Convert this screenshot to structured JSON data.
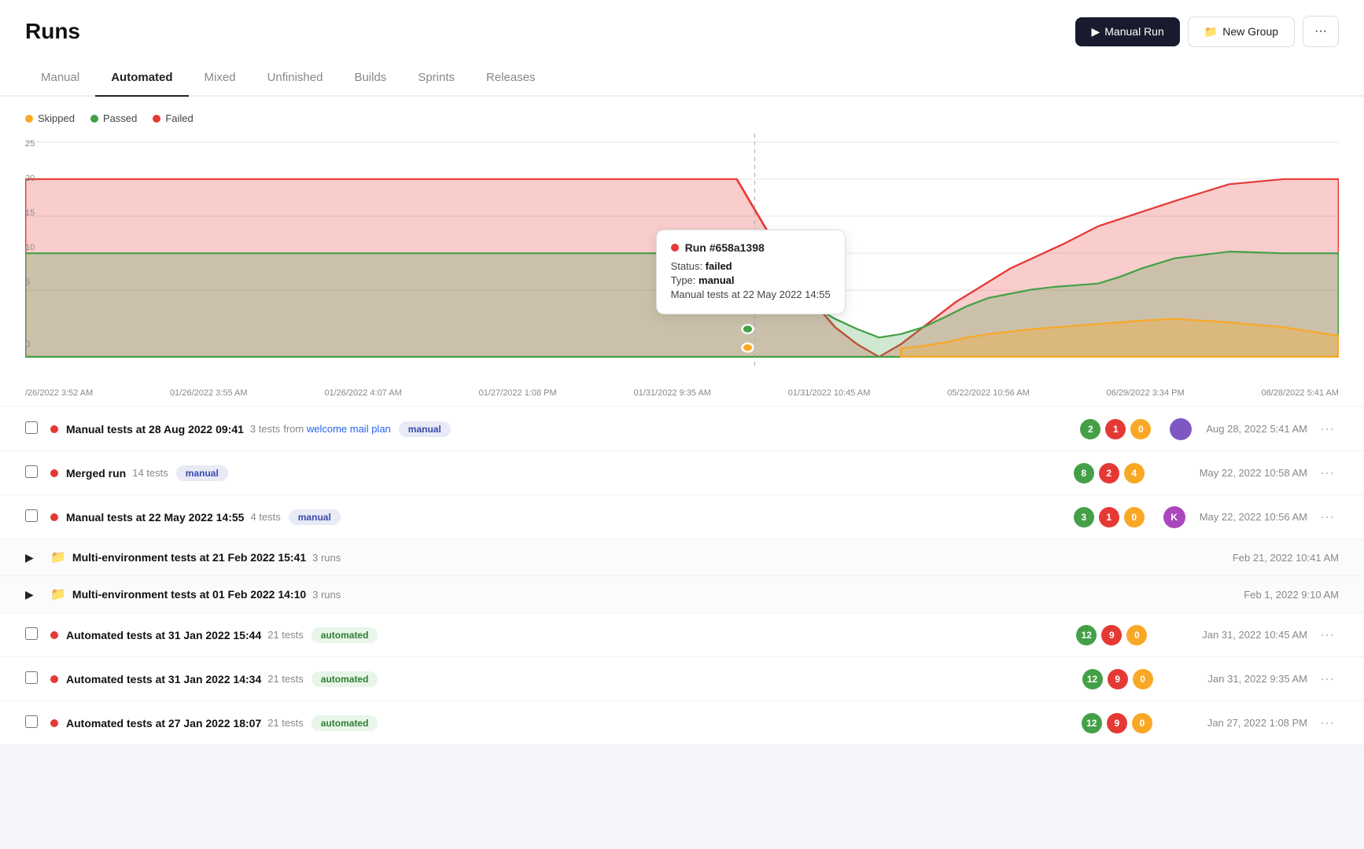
{
  "header": {
    "title": "Runs",
    "manual_run_label": "Manual Run",
    "new_group_label": "New Group",
    "more_icon": "···"
  },
  "tabs": [
    {
      "label": "Manual",
      "active": false
    },
    {
      "label": "Automated",
      "active": false
    },
    {
      "label": "Mixed",
      "active": false
    },
    {
      "label": "Unfinished",
      "active": false
    },
    {
      "label": "Builds",
      "active": false
    },
    {
      "label": "Sprints",
      "active": false
    },
    {
      "label": "Releases",
      "active": false
    }
  ],
  "chart": {
    "legend": [
      {
        "label": "Skipped",
        "color": "#f9a825"
      },
      {
        "label": "Passed",
        "color": "#43a047"
      },
      {
        "label": "Failed",
        "color": "#e53935"
      }
    ],
    "y_labels": [
      "25",
      "20",
      "15",
      "10",
      "5",
      "0"
    ],
    "x_labels": [
      "/26/2022 3:52 AM",
      "01/26/2022 3:55 AM",
      "01/26/2022 4:07 AM",
      "01/27/2022 1:08 PM",
      "01/31/2022 9:35 AM",
      "01/31/2022 10:45 AM",
      "05/22/2022 10:56 AM",
      "06/29/2022 3:34 PM",
      "08/28/2022 5:41 AM"
    ],
    "tooltip": {
      "run_id": "Run #658a1398",
      "status_label": "Status:",
      "status_value": "failed",
      "type_label": "Type:",
      "type_value": "manual",
      "description": "Manual tests at 22 May 2022 14:55"
    }
  },
  "runs": [
    {
      "type": "run",
      "checked": false,
      "dot": true,
      "name": "Manual tests at 28 Aug 2022 09:41",
      "test_count": "3 tests",
      "from_label": "from",
      "from_link": "welcome mail plan",
      "badge": "manual",
      "badge_type": "manual",
      "counts": [
        2,
        1,
        0
      ],
      "avatar_initials": "",
      "avatar_type": "purple",
      "has_avatar": true,
      "date": "Aug 28, 2022 5:41 AM"
    },
    {
      "type": "run",
      "checked": false,
      "dot": true,
      "name": "Merged run",
      "test_count": "14 tests",
      "badge": "manual",
      "badge_type": "manual",
      "counts": [
        8,
        2,
        4
      ],
      "has_avatar": false,
      "date": "May 22, 2022 10:58 AM"
    },
    {
      "type": "run",
      "checked": false,
      "dot": true,
      "name": "Manual tests at 22 May 2022 14:55",
      "test_count": "4 tests",
      "badge": "manual",
      "badge_type": "manual",
      "counts": [
        3,
        1,
        0
      ],
      "avatar_initials": "K",
      "avatar_type": "K",
      "has_avatar": true,
      "date": "May 22, 2022 10:56 AM"
    },
    {
      "type": "group",
      "name": "Multi-environment tests at 21 Feb 2022 15:41",
      "runs_count": "3 runs",
      "date": "Feb 21, 2022 10:41 AM"
    },
    {
      "type": "group",
      "name": "Multi-environment tests at 01 Feb 2022 14:10",
      "runs_count": "3 runs",
      "date": "Feb 1, 2022 9:10 AM"
    },
    {
      "type": "run",
      "checked": false,
      "dot": true,
      "name": "Automated tests at 31 Jan 2022 15:44",
      "test_count": "21 tests",
      "badge": "automated",
      "badge_type": "automated",
      "counts": [
        12,
        9,
        0
      ],
      "has_avatar": false,
      "date": "Jan 31, 2022 10:45 AM"
    },
    {
      "type": "run",
      "checked": false,
      "dot": true,
      "name": "Automated tests at 31 Jan 2022 14:34",
      "test_count": "21 tests",
      "badge": "automated",
      "badge_type": "automated",
      "counts": [
        12,
        9,
        0
      ],
      "has_avatar": false,
      "date": "Jan 31, 2022 9:35 AM"
    },
    {
      "type": "run",
      "checked": false,
      "dot": true,
      "name": "Automated tests at 27 Jan 2022 18:07",
      "test_count": "21 tests",
      "badge": "automated",
      "badge_type": "automated",
      "counts": [
        12,
        9,
        0
      ],
      "has_avatar": false,
      "date": "Jan 27, 2022 1:08 PM"
    }
  ]
}
